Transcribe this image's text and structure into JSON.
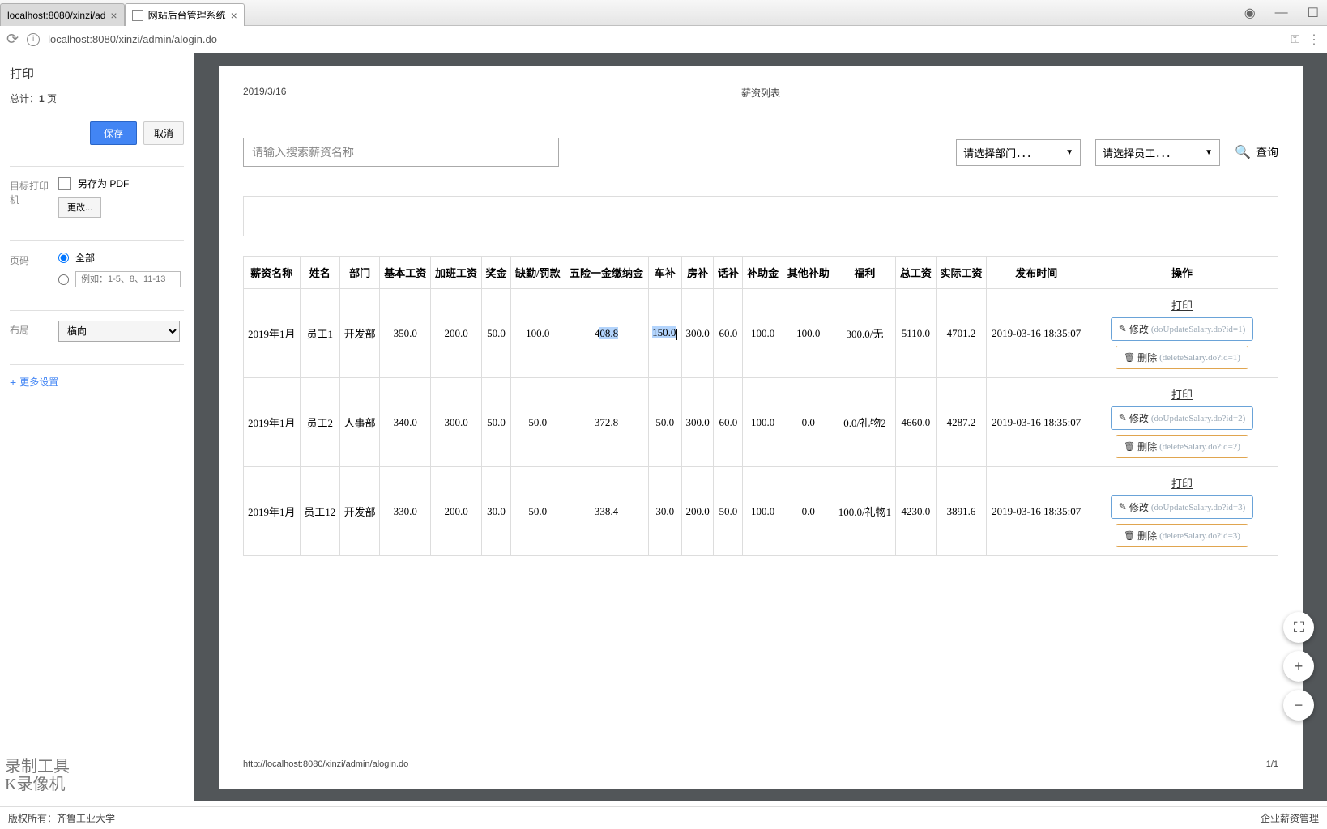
{
  "browser": {
    "tabs": [
      {
        "label": "localhost:8080/xinzi/ad"
      },
      {
        "label": "网站后台管理系统"
      }
    ],
    "url": "localhost:8080/xinzi/admin/alogin.do"
  },
  "printPanel": {
    "title": "打印",
    "totalPrefix": "总计：",
    "totalCount": "1",
    "totalSuffix": " 页",
    "saveBtn": "保存",
    "cancelBtn": "取消",
    "destLabel": "目标打印机",
    "destValue": "另存为 PDF",
    "changeBtn": "更改...",
    "pagesLabel": "页码",
    "pagesAll": "全部",
    "pagesRangePlaceholder": "例如：1-5、8、11-13",
    "layoutLabel": "布局",
    "layoutValue": "横向",
    "moreSettings": "更多设置"
  },
  "preview": {
    "date": "2019/3/16",
    "headerTitle": "薪资列表",
    "searchPlaceholder": "请输入搜索薪资名称",
    "deptSelect": "请选择部门．．．",
    "empSelect": "请选择员工．．．",
    "queryBtn": "查询",
    "footerUrl": "http://localhost:8080/xinzi/admin/alogin.do",
    "footerPage": "1/1"
  },
  "table": {
    "headers": [
      "薪资名称",
      "姓名",
      "部门",
      "基本工资",
      "加班工资",
      "奖金",
      "缺勤/罚款",
      "五险一金缴纳金",
      "车补",
      "房补",
      "话补",
      "补助金",
      "其他补助",
      "福利",
      "总工资",
      "实际工资",
      "发布时间",
      "操作"
    ],
    "printLabel": "打印",
    "editLabel": "修改",
    "deleteLabel": "删除",
    "rows": [
      {
        "cells": [
          "2019年1月",
          "员工1",
          "开发部",
          "350.0",
          "200.0",
          "50.0",
          "100.0",
          "408.8",
          "150.0",
          "300.0",
          "60.0",
          "100.0",
          "100.0",
          "300.0/无",
          "5110.0",
          "4701.2",
          "2019-03-16 18:35:07"
        ],
        "editUrl": "(doUpdateSalary.do?id=1)",
        "delUrl": "(deleteSalary.do?id=1)",
        "highlightCol8": true,
        "highlightCol9": true
      },
      {
        "cells": [
          "2019年1月",
          "员工2",
          "人事部",
          "340.0",
          "300.0",
          "50.0",
          "50.0",
          "372.8",
          "50.0",
          "300.0",
          "60.0",
          "100.0",
          "0.0",
          "0.0/礼物2",
          "4660.0",
          "4287.2",
          "2019-03-16 18:35:07"
        ],
        "editUrl": "(doUpdateSalary.do?id=2)",
        "delUrl": "(deleteSalary.do?id=2)"
      },
      {
        "cells": [
          "2019年1月",
          "员工12",
          "开发部",
          "330.0",
          "200.0",
          "30.0",
          "50.0",
          "338.4",
          "30.0",
          "200.0",
          "50.0",
          "100.0",
          "0.0",
          "100.0/礼物1",
          "4230.0",
          "3891.6",
          "2019-03-16 18:35:07"
        ],
        "editUrl": "(doUpdateSalary.do?id=3)",
        "delUrl": "(deleteSalary.do?id=3)"
      }
    ]
  },
  "watermark": {
    "line1": "录制工具",
    "line2": "K录像机"
  },
  "bottomBar": {
    "left": "版权所有：齐鲁工业大学",
    "right": "企业薪资管理"
  }
}
